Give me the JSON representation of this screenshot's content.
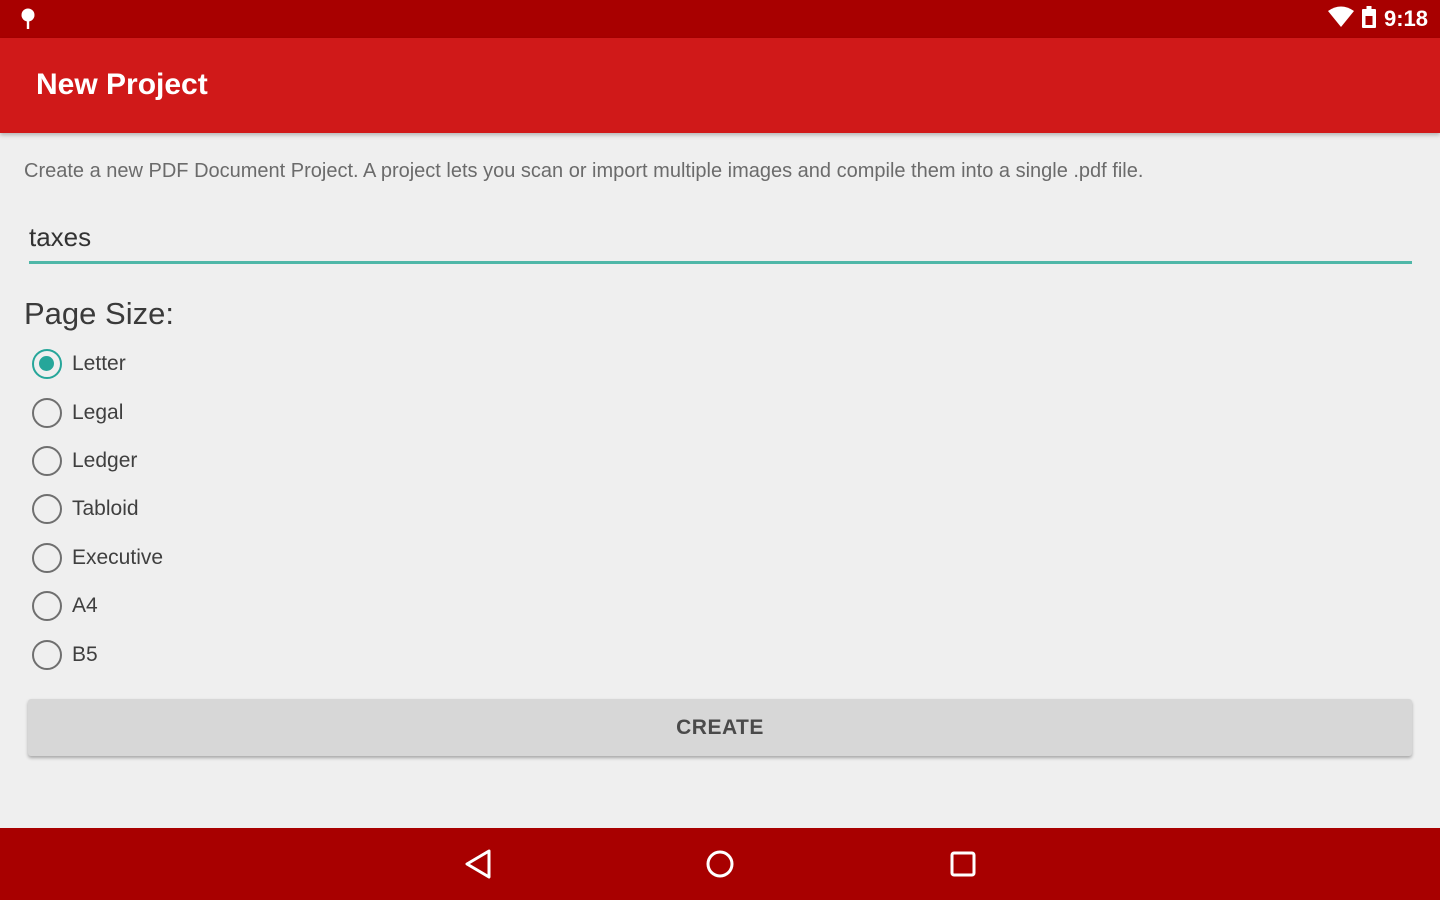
{
  "status_bar": {
    "time": "9:18",
    "left_icon": "notification-pin-icon",
    "wifi_icon": "wifi-icon",
    "battery_icon": "battery-icon"
  },
  "app_bar": {
    "title": "New Project"
  },
  "description": "Create a new PDF Document Project.  A project lets you scan or import multiple images and compile them into a single .pdf file.",
  "name_field": {
    "value": "taxes"
  },
  "page_size": {
    "label": "Page Size:",
    "selected": "Letter",
    "options": [
      "Letter",
      "Legal",
      "Ledger",
      "Tabloid",
      "Executive",
      "A4",
      "B5"
    ]
  },
  "create_button": {
    "label": "CREATE"
  },
  "nav_bar": {
    "back_icon": "back-icon",
    "home_icon": "home-icon",
    "recents_icon": "recents-icon"
  },
  "colors": {
    "status_bar": "#a80000",
    "app_bar": "#d01919",
    "accent": "#26a69a",
    "background": "#efefef"
  }
}
